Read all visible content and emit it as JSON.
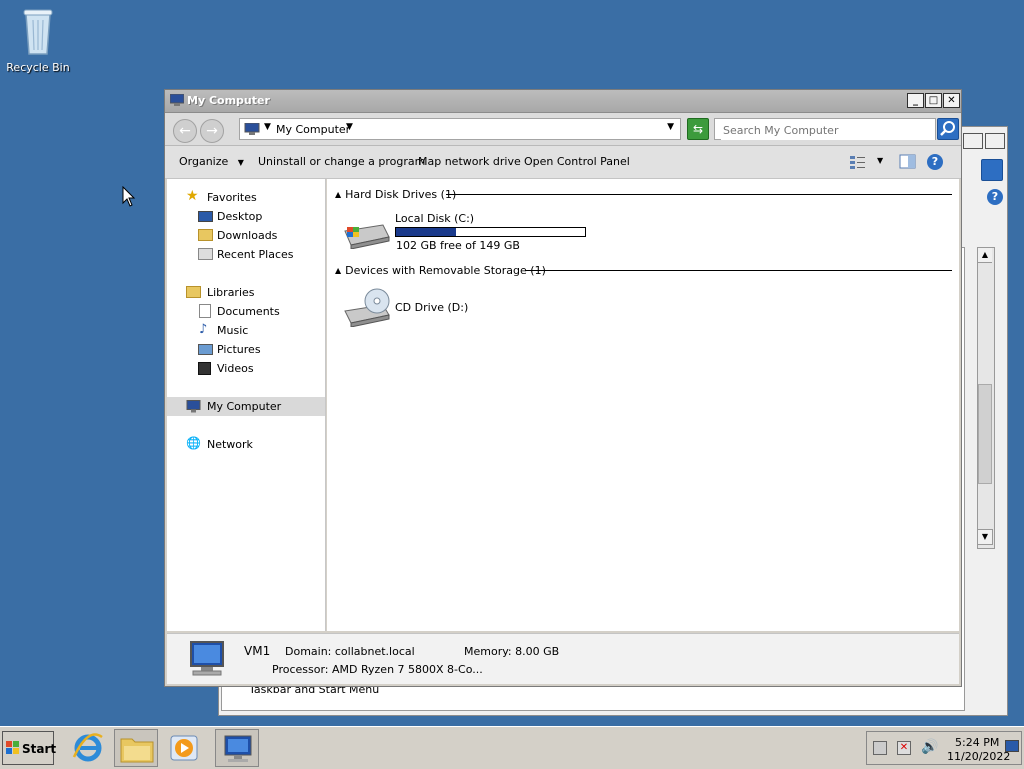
{
  "desktop": {
    "icons": [
      {
        "label": "Recycle Bin"
      }
    ]
  },
  "background_window": {
    "text": "Taskbar and Start Menu"
  },
  "window": {
    "title": "My Computer",
    "address": {
      "crumb": "My Computer"
    },
    "search": {
      "placeholder": "Search My Computer"
    },
    "toolbar": {
      "organize": "Organize",
      "uninstall": "Uninstall or change a program",
      "map_drive": "Map network drive",
      "control_panel": "Open Control Panel"
    },
    "nav": {
      "favorites": "Favorites",
      "desktop": "Desktop",
      "downloads": "Downloads",
      "recent": "Recent Places",
      "libraries": "Libraries",
      "documents": "Documents",
      "music": "Music",
      "pictures": "Pictures",
      "videos": "Videos",
      "computer": "My Computer",
      "network": "Network"
    },
    "groups": {
      "hdd": "Hard Disk Drives (1)",
      "removable": "Devices with Removable Storage (1)"
    },
    "drives": {
      "c": {
        "name": "Local Disk (C:)",
        "free": "102 GB free of 149 GB",
        "used_fraction": 0.315
      },
      "d": {
        "name": "CD Drive (D:)"
      }
    },
    "details": {
      "name": "VM1",
      "domain": "Domain: collabnet.local",
      "memory": "Memory: 8.00 GB",
      "processor": "Processor: AMD Ryzen 7 5800X 8-Co..."
    }
  },
  "taskbar": {
    "start": "Start",
    "time": "5:24 PM",
    "date": "11/20/2022"
  },
  "colors": {
    "desktop": "#3a6ea5",
    "accent": "#2d6ec2",
    "drive_bar": "#1a3a8c"
  }
}
